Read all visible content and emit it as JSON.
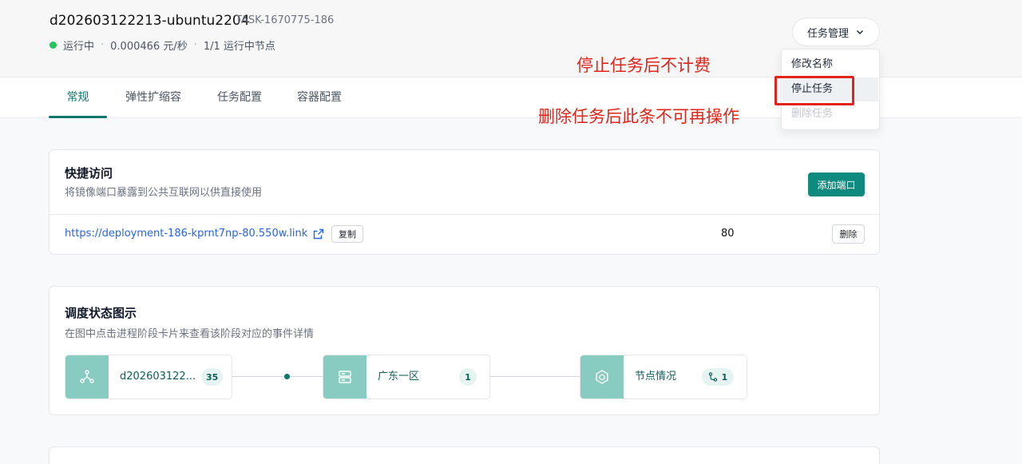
{
  "header": {
    "title": "d202603122213-ubuntu2204",
    "task_id": "TASK-1670775-186",
    "status": "运行中",
    "price": "0.000466 元/秒",
    "nodes": "1/1 运行中节点",
    "separator": "·",
    "task_menu_label": "任务管理"
  },
  "tabs": [
    "常规",
    "弹性扩缩容",
    "任务配置",
    "容器配置"
  ],
  "dropdown": {
    "items": [
      {
        "label": "修改名称"
      },
      {
        "label": "停止任务"
      },
      {
        "label": "删除任务"
      }
    ]
  },
  "annotations": {
    "stop_note": "停止任务后不计费",
    "delete_note": "删除任务后此条不可再操作"
  },
  "quick_access": {
    "title": "快捷访问",
    "subtitle": "将镜像端口暴露到公共互联网以供直接使用",
    "add_port_label": "添加端口",
    "link": "https://deployment-186-kprnt7np-80.550w.link",
    "copy_label": "复制",
    "port": "80",
    "delete_label": "删除"
  },
  "schedule": {
    "title": "调度状态图示",
    "subtitle": "在图中点击进程阶段卡片来查看该阶段对应的事件详情",
    "stages": [
      {
        "label": "d202603122...",
        "badge": "35",
        "icon": "hub-icon"
      },
      {
        "label": "广东一区",
        "badge": "1",
        "icon": "server-icon"
      },
      {
        "label": "节点情况",
        "badge": "1",
        "icon": "node-icon"
      }
    ]
  },
  "colors": {
    "accent": "#0f766e",
    "running": "#22c55e",
    "annotation": "#e3241b",
    "stage_icon_bg": "#87cbc1"
  }
}
